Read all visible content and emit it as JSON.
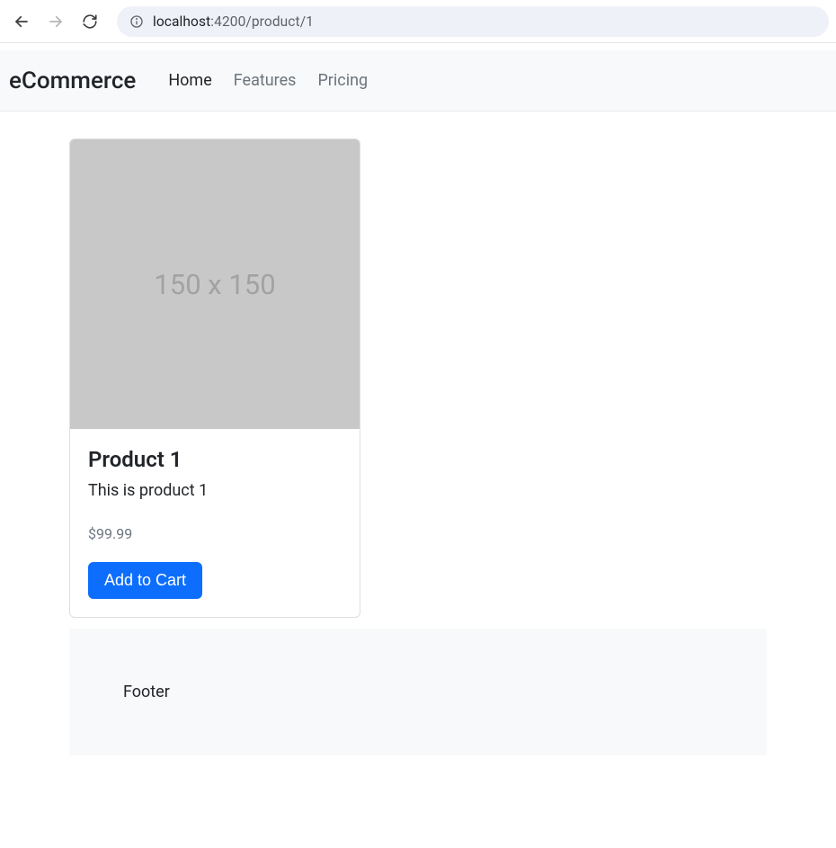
{
  "browser": {
    "url": {
      "host": "localhost",
      "port_path": ":4200/product/1"
    }
  },
  "navbar": {
    "brand": "eCommerce",
    "links": [
      {
        "label": "Home",
        "active": true
      },
      {
        "label": "Features",
        "active": false
      },
      {
        "label": "Pricing",
        "active": false
      }
    ]
  },
  "product": {
    "image_placeholder": "150 x 150",
    "title": "Product 1",
    "description": "This is product 1",
    "price": "$99.99",
    "add_to_cart_label": "Add to Cart"
  },
  "footer": {
    "text": "Footer"
  }
}
